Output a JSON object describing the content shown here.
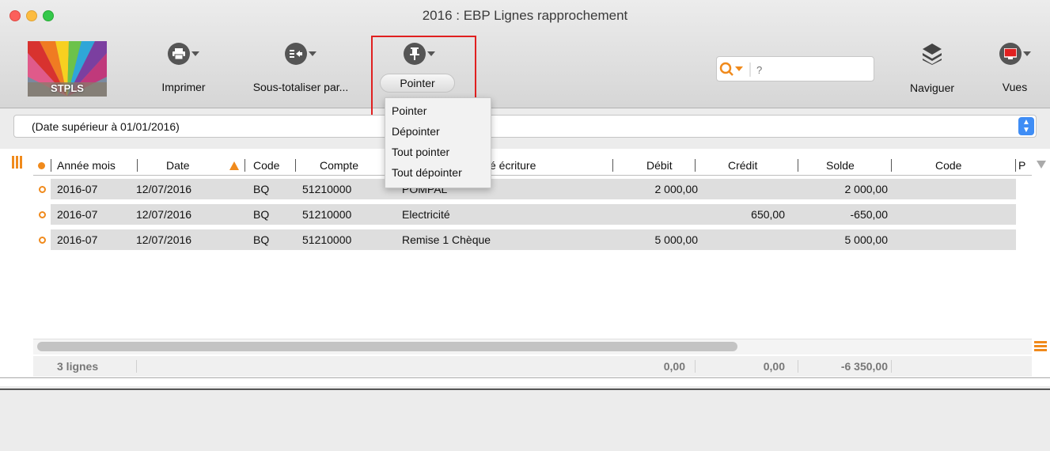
{
  "window": {
    "title": "2016 : EBP Lignes rapprochement"
  },
  "toolbar": {
    "logo_text": "STPLS",
    "print_label": "Imprimer",
    "subtotal_label": "Sous-totaliser par...",
    "pointer_label": "Pointer",
    "search_placeholder": "?",
    "navigate_label": "Naviguer",
    "views_label": "Vues"
  },
  "filter": {
    "text": "(Date supérieur à 01/01/2016)"
  },
  "pointer_menu": {
    "items": [
      "Pointer",
      "Dépointer",
      "Tout pointer",
      "Tout dépointer"
    ]
  },
  "table": {
    "columns": [
      "Année mois",
      "Date",
      "Code",
      "Compte",
      "Libellé écriture",
      "Débit",
      "Crédit",
      "Solde",
      "Code",
      "P"
    ],
    "header_visible": {
      "libelle_suffix": "é écriture"
    },
    "rows": [
      {
        "year_month": "2016-07",
        "date": "12/07/2016",
        "code": "BQ",
        "account": "51210000",
        "label": "POMPAL",
        "debit": "2 000,00",
        "credit": "",
        "balance": "2 000,00",
        "code2": ""
      },
      {
        "year_month": "2016-07",
        "date": "12/07/2016",
        "code": "BQ",
        "account": "51210000",
        "label": "Electricité",
        "debit": "",
        "credit": "650,00",
        "balance": "-650,00",
        "code2": ""
      },
      {
        "year_month": "2016-07",
        "date": "12/07/2016",
        "code": "BQ",
        "account": "51210000",
        "label": "Remise 1 Chèque",
        "debit": "5 000,00",
        "credit": "",
        "balance": "5 000,00",
        "code2": ""
      }
    ],
    "totals": {
      "count": "3 lignes",
      "debit": "0,00",
      "credit": "0,00",
      "balance": "-6 350,00"
    }
  },
  "colors": {
    "accent": "#f08a1c",
    "highlight": "#e02020",
    "stepper": "#3f8df5"
  },
  "icons": [
    "printer-icon",
    "subtotal-icon",
    "pin-icon",
    "search-icon",
    "layers-icon",
    "monitor-icon"
  ]
}
